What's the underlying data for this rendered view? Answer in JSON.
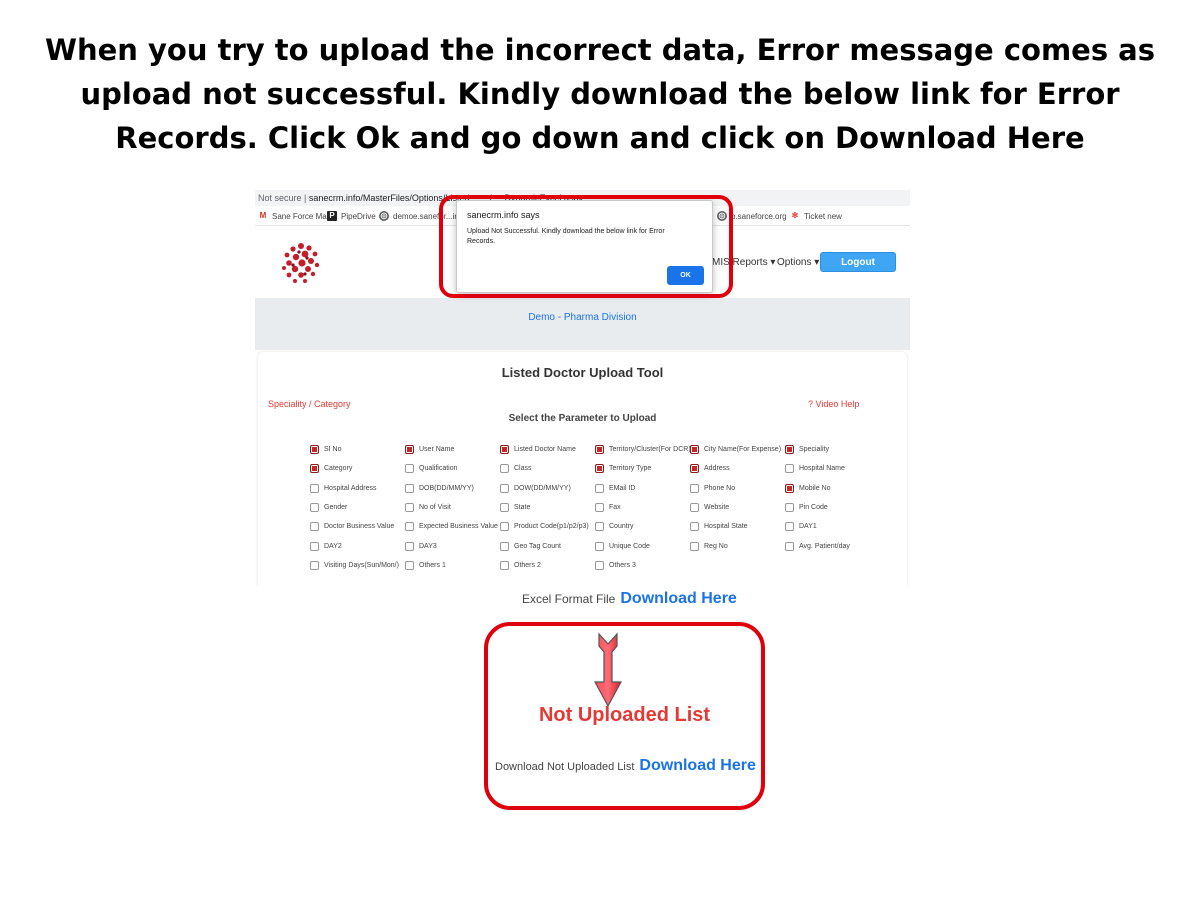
{
  "slide": {
    "title": "When you try to upload the incorrect data, Error message comes as upload not successful. Kindly download the below link for Error Records. Click Ok and go down and click on Download Here"
  },
  "browser": {
    "security": "Not secure",
    "url": "sanecrm.info/MasterFiles/Options/Listed..._.../..._DynamicExcel.aspx",
    "bookmarks": [
      {
        "label": "Sane Force Mail",
        "icon": "gmail-icon"
      },
      {
        "label": "PipeDrive",
        "icon": "pipedrive-icon"
      },
      {
        "label": "demoe.sanefor...in...",
        "icon": "globe-icon"
      },
      {
        "label": "b.saneforce.org",
        "icon": "globe-icon"
      },
      {
        "label": "Ticket new",
        "icon": "ticket-icon"
      }
    ]
  },
  "header": {
    "nav_mis": "MIS Reports",
    "nav_options": "Options",
    "logout_label": "Logout"
  },
  "division": "Demo - Pharma Division",
  "tool": {
    "title": "Listed Doctor Upload Tool",
    "speciality_link": "Speciality / Category",
    "video_help": "? Video Help",
    "select_param": "Select the Parameter to Upload"
  },
  "params": [
    {
      "label": "SI No",
      "checked": true
    },
    {
      "label": "User Name",
      "checked": true
    },
    {
      "label": "Listed Doctor Name",
      "checked": true
    },
    {
      "label": "Territory/Cluster(For DCR)",
      "checked": true
    },
    {
      "label": "City Name(For Expense)",
      "checked": true
    },
    {
      "label": "Speciality",
      "checked": true
    },
    {
      "label": "Category",
      "checked": true
    },
    {
      "label": "Qualification",
      "checked": false
    },
    {
      "label": "Class",
      "checked": false
    },
    {
      "label": "Territory Type",
      "checked": true
    },
    {
      "label": "Address",
      "checked": true
    },
    {
      "label": "Hospital Name",
      "checked": false
    },
    {
      "label": "Hospital Address",
      "checked": false
    },
    {
      "label": "DOB(DD/MM/YY)",
      "checked": false
    },
    {
      "label": "DOW(DD/MM/YY)",
      "checked": false
    },
    {
      "label": "EMail ID",
      "checked": false
    },
    {
      "label": "Phone No",
      "checked": false
    },
    {
      "label": "Mobile No",
      "checked": true
    },
    {
      "label": "Gender",
      "checked": false
    },
    {
      "label": "No of Visit",
      "checked": false
    },
    {
      "label": "State",
      "checked": false
    },
    {
      "label": "Fax",
      "checked": false
    },
    {
      "label": "Website",
      "checked": false
    },
    {
      "label": "Pin Code",
      "checked": false
    },
    {
      "label": "Doctor Business Value",
      "checked": false
    },
    {
      "label": "Expected Business Value",
      "checked": false
    },
    {
      "label": "Product Code(p1/p2/p3)",
      "checked": false
    },
    {
      "label": "Country",
      "checked": false
    },
    {
      "label": "Hospital State",
      "checked": false
    },
    {
      "label": "DAY1",
      "checked": false
    },
    {
      "label": "DAY2",
      "checked": false
    },
    {
      "label": "DAY3",
      "checked": false
    },
    {
      "label": "Geo Tag Count",
      "checked": false
    },
    {
      "label": "Unique Code",
      "checked": false
    },
    {
      "label": "Reg No",
      "checked": false
    },
    {
      "label": "Avg. Patient/day",
      "checked": false
    },
    {
      "label": "Visiting Days(Sun/Mon/)",
      "checked": false
    },
    {
      "label": "Others 1",
      "checked": false
    },
    {
      "label": "Others 2",
      "checked": false
    },
    {
      "label": "Others 3",
      "checked": false
    }
  ],
  "dialog": {
    "title": "sanecrm.info says",
    "message": "Upload Not Successful. Kindly download the below link for Error Records.",
    "ok_label": "OK"
  },
  "excel": {
    "label": "Excel Format File",
    "link": "Download Here"
  },
  "not_uploaded": {
    "title": "Not Uploaded List",
    "label": "Download Not Uploaded List",
    "link": "Download Here"
  },
  "colors": {
    "highlight": "#e0000c",
    "link": "#1a73e8",
    "checked": "#c62828",
    "logout": "#3ea6f5"
  }
}
